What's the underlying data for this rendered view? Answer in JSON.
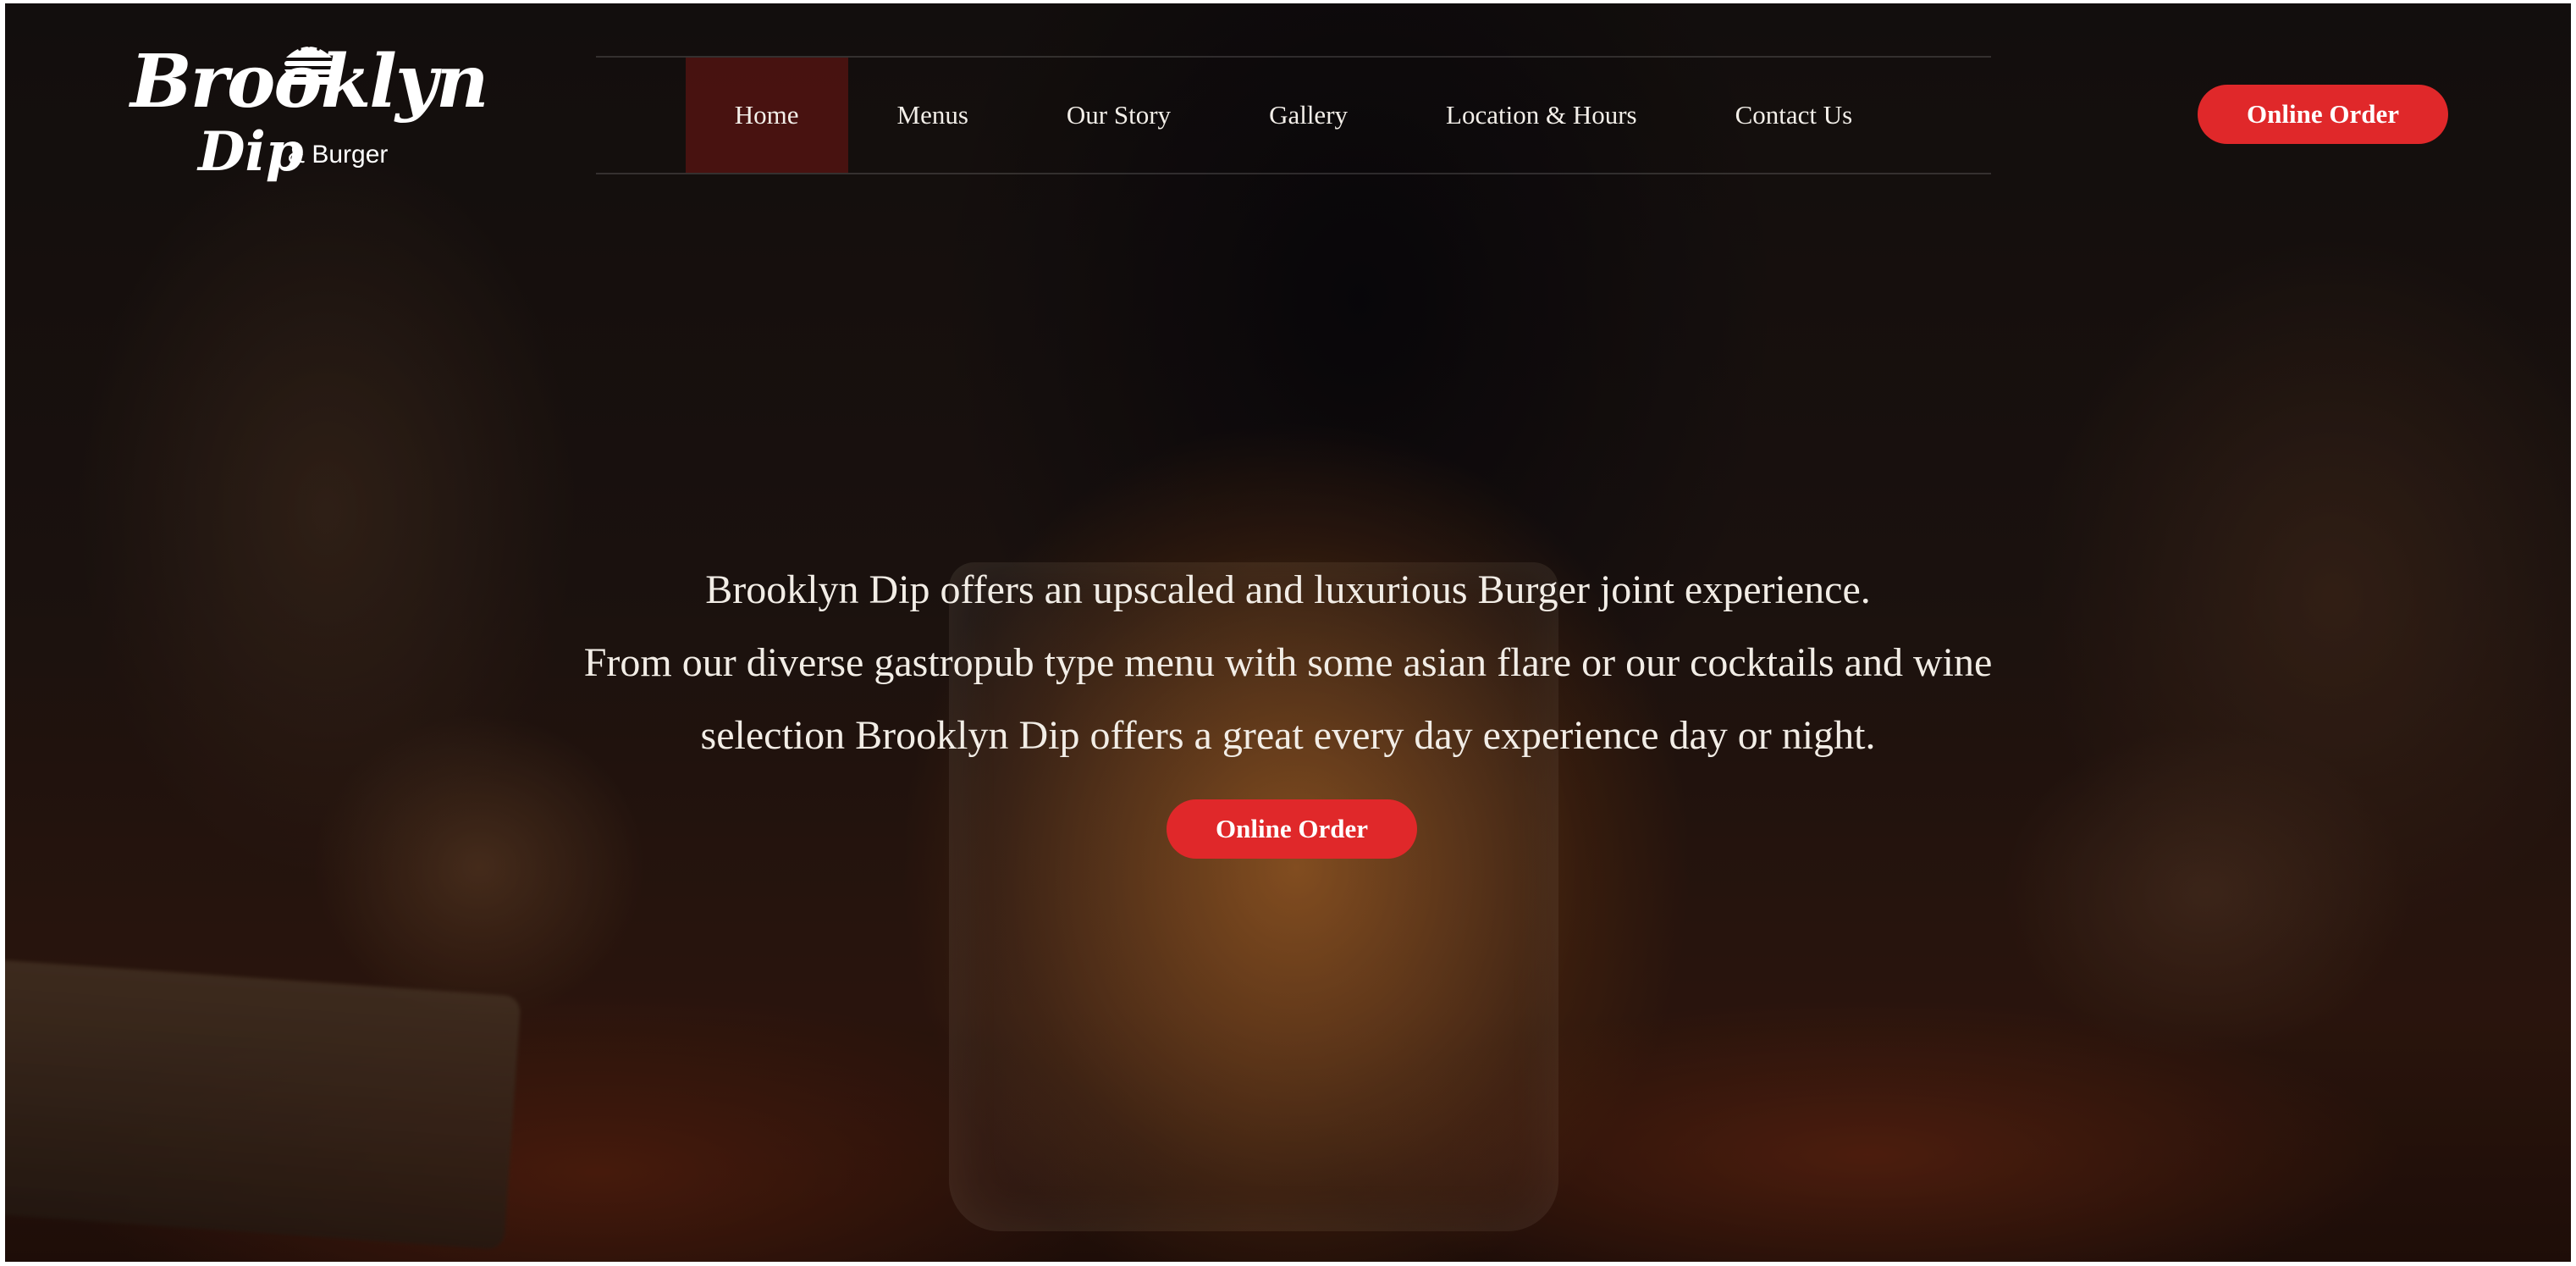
{
  "logo": {
    "name_line1": "Brooklyn",
    "name_line2": "Dip",
    "name_sub": "& Burger",
    "icon": "burger-icon"
  },
  "nav": {
    "items": [
      {
        "label": "Home",
        "active": true
      },
      {
        "label": "Menus"
      },
      {
        "label": "Our Story"
      },
      {
        "label": "Gallery"
      },
      {
        "label": "Location & Hours"
      },
      {
        "label": "Contact Us"
      }
    ]
  },
  "header_button": {
    "label": "Online Order"
  },
  "hero": {
    "lines": [
      "Brooklyn Dip offers an upscaled and luxurious Burger joint experience.",
      "From our diverse gastropub type menu with some asian flare or our cocktails and wine",
      "selection Brooklyn Dip offers a great every day experience day or night."
    ],
    "button_label": "Online Order"
  },
  "colors": {
    "accent": "#e0282a",
    "active_nav": "#5a1412"
  }
}
